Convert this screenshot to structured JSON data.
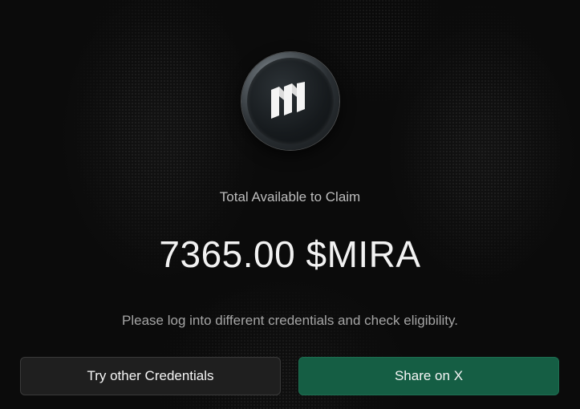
{
  "claim": {
    "label": "Total Available to Claim",
    "amount": "7365.00 $MIRA",
    "note": "Please log into different credentials and check eligibility."
  },
  "actions": {
    "secondary_label": "Try other Credentials",
    "primary_label": "Share on X"
  },
  "logo": {
    "icon": "mira-logo-icon"
  },
  "colors": {
    "background": "#0b0b0b",
    "primary_button": "#155e44",
    "secondary_button": "#1f1f1f",
    "text": "#f2f2f2"
  }
}
